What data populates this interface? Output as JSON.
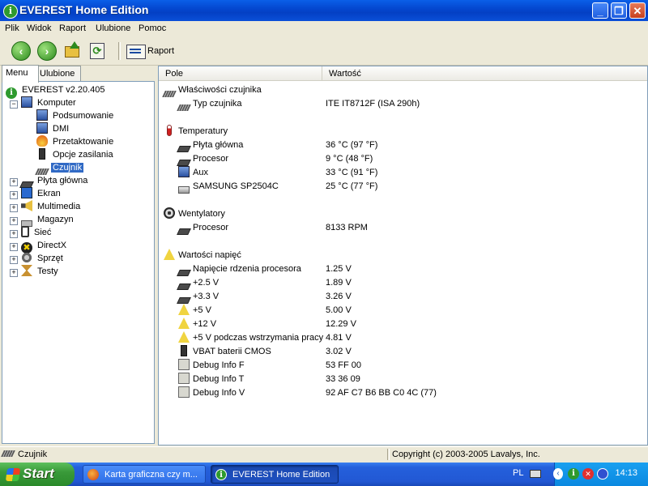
{
  "window": {
    "title": "EVEREST Home Edition",
    "icon": "info-icon",
    "buttons": {
      "minimize": "_",
      "maximize": "❐",
      "close": "✕"
    }
  },
  "menu": [
    "Plik",
    "Widok",
    "Raport",
    "Ulubione",
    "Pomoc"
  ],
  "toolbar": {
    "back_icon": "arrow-left-icon",
    "forward_icon": "arrow-right-icon",
    "up_icon": "up-folder-icon",
    "refresh_icon": "refresh-icon",
    "report_label": "Raport"
  },
  "left_tabs": [
    "Menu",
    "Ulubione"
  ],
  "tree": [
    {
      "label": "EVEREST v2.20.405",
      "icon": "info-icon",
      "level": 0,
      "expander": ""
    },
    {
      "label": "Komputer",
      "icon": "computer-icon",
      "level": 1,
      "expander": "−"
    },
    {
      "label": "Podsumowanie",
      "icon": "computer-icon",
      "level": 2,
      "expander": ""
    },
    {
      "label": "DMI",
      "icon": "computer-icon",
      "level": 2,
      "expander": ""
    },
    {
      "label": "Przetaktowanie",
      "icon": "fire-icon",
      "level": 2,
      "expander": ""
    },
    {
      "label": "Opcje zasilania",
      "icon": "power-icon",
      "level": 2,
      "expander": ""
    },
    {
      "label": "Czujnik",
      "icon": "sensor-icon",
      "level": 2,
      "expander": "",
      "selected": true
    },
    {
      "label": "Płyta główna",
      "icon": "motherboard-icon",
      "level": 1,
      "expander": "+"
    },
    {
      "label": "Ekran",
      "icon": "monitor-icon",
      "level": 1,
      "expander": "+"
    },
    {
      "label": "Multimedia",
      "icon": "speaker-icon",
      "level": 1,
      "expander": "+"
    },
    {
      "label": "Magazyn",
      "icon": "storage-icon",
      "level": 1,
      "expander": "+"
    },
    {
      "label": "Sieć",
      "icon": "network-icon",
      "level": 1,
      "expander": "+"
    },
    {
      "label": "DirectX",
      "icon": "directx-icon",
      "level": 1,
      "expander": "+"
    },
    {
      "label": "Sprzęt",
      "icon": "device-icon",
      "level": 1,
      "expander": "+"
    },
    {
      "label": "Testy",
      "icon": "hourglass-icon",
      "level": 1,
      "expander": "+"
    }
  ],
  "columns": {
    "field": "Pole",
    "value": "Wartość"
  },
  "rows": [
    {
      "type": "section",
      "field": "Właściwości czujnika",
      "icon": "sensor-icon"
    },
    {
      "type": "item",
      "field": "Typ czujnika",
      "value": "ITE IT8712F  (ISA 290h)",
      "icon": "sensor-icon"
    },
    {
      "type": "spacer"
    },
    {
      "type": "section",
      "field": "Temperatury",
      "icon": "thermometer-icon"
    },
    {
      "type": "item",
      "field": "Płyta główna",
      "value": "36 °C  (97 °F)",
      "icon": "motherboard-icon"
    },
    {
      "type": "item",
      "field": "Procesor",
      "value": "9 °C  (48 °F)",
      "icon": "cpu-icon"
    },
    {
      "type": "item",
      "field": "Aux",
      "value": "33 °C  (91 °F)",
      "icon": "computer-icon"
    },
    {
      "type": "item",
      "field": "SAMSUNG SP2504C",
      "value": "25 °C  (77 °F)",
      "icon": "hdd-icon"
    },
    {
      "type": "spacer"
    },
    {
      "type": "section",
      "field": "Wentylatory",
      "icon": "fan-icon"
    },
    {
      "type": "item",
      "field": "Procesor",
      "value": "8133 RPM",
      "icon": "cpu-icon"
    },
    {
      "type": "spacer"
    },
    {
      "type": "section",
      "field": "Wartości napięć",
      "icon": "warning-icon"
    },
    {
      "type": "item",
      "field": "Napięcie rdzenia procesora",
      "value": "1.25 V",
      "icon": "cpu-icon"
    },
    {
      "type": "item",
      "field": "+2.5 V",
      "value": "1.89 V",
      "icon": "cpu-icon"
    },
    {
      "type": "item",
      "field": "+3.3 V",
      "value": "3.26 V",
      "icon": "cpu-icon"
    },
    {
      "type": "item",
      "field": "+5 V",
      "value": "5.00 V",
      "icon": "warning-icon"
    },
    {
      "type": "item",
      "field": "+12 V",
      "value": "12.29 V",
      "icon": "warning-icon"
    },
    {
      "type": "item",
      "field": "+5 V podczas wstrzymania pracy",
      "value": "4.81 V",
      "icon": "warning-icon"
    },
    {
      "type": "item",
      "field": "VBAT baterii CMOS",
      "value": "3.02 V",
      "icon": "battery-icon"
    },
    {
      "type": "item",
      "field": "Debug Info F",
      "value": "53 FF 00",
      "icon": "debug-icon"
    },
    {
      "type": "item",
      "field": "Debug Info T",
      "value": "33 36 09",
      "icon": "debug-icon"
    },
    {
      "type": "item",
      "field": "Debug Info V",
      "value": "92 AF C7 B6 BB C0 4C (77)",
      "icon": "debug-icon"
    }
  ],
  "status": {
    "left": "Czujnik",
    "right": "Copyright (c) 2003-2005 Lavalys, Inc."
  },
  "taskbar": {
    "start": "Start",
    "tasks": [
      {
        "label": "Karta graficzna czy m...",
        "icon": "firefox-icon"
      },
      {
        "label": "EVEREST Home Edition",
        "icon": "info-icon"
      }
    ],
    "lang": "PL",
    "clock": "14:13"
  }
}
